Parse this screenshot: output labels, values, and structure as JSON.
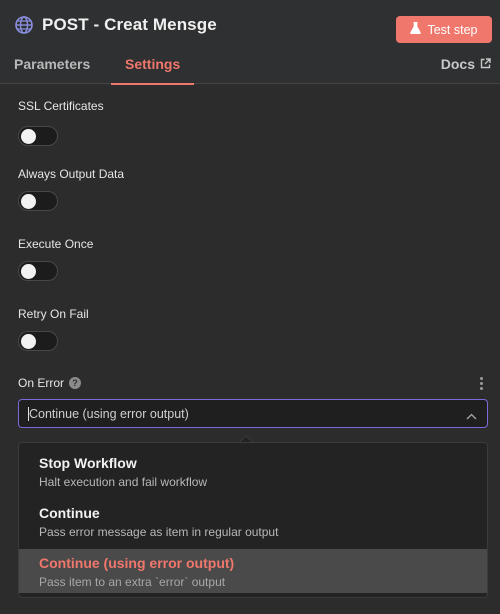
{
  "header": {
    "title": "POST - Creat Mensge",
    "test_button_label": "Test step",
    "tabs": [
      {
        "label": "Parameters",
        "active": false
      },
      {
        "label": "Settings",
        "active": true
      }
    ],
    "docs_label": "Docs"
  },
  "settings": {
    "toggles": [
      {
        "label": "SSL Certificates",
        "on": false
      },
      {
        "label": "Always Output Data",
        "on": false
      },
      {
        "label": "Execute Once",
        "on": false
      },
      {
        "label": "Retry On Fail",
        "on": false
      }
    ],
    "on_error": {
      "label": "On Error",
      "selected_value": "Continue (using error output)",
      "options": [
        {
          "title": "Stop Workflow",
          "description": "Halt execution and fail workflow",
          "selected": false
        },
        {
          "title": "Continue",
          "description": "Pass error message as item in regular output",
          "selected": false
        },
        {
          "title": "Continue (using error output)",
          "description": "Pass item to an extra `error` output",
          "selected": true
        }
      ]
    }
  },
  "colors": {
    "accent": "#f0776c",
    "focus_border": "#7b6ad8",
    "background": "#2c2c2c"
  },
  "icons": {
    "node": "globe-icon",
    "test": "flask-icon",
    "docs": "external-link-icon",
    "help": "help-icon",
    "menu": "kebab-icon",
    "select": "chevron-up-icon"
  }
}
